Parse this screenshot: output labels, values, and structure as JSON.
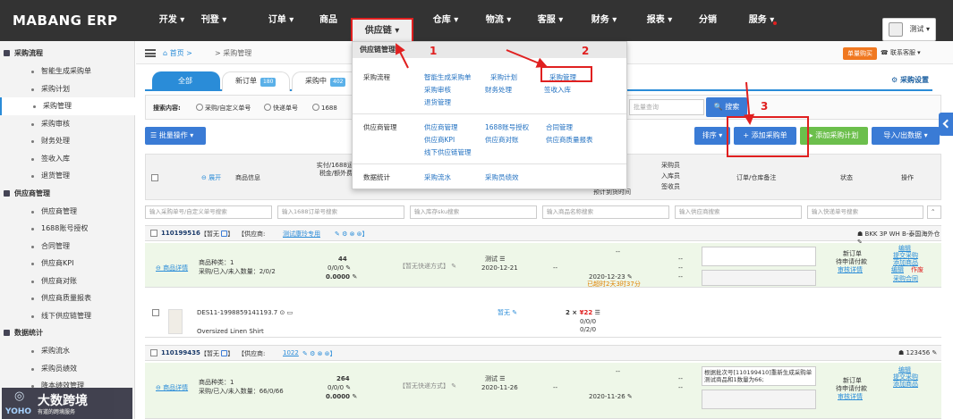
{
  "app": {
    "logo": "MABANG ERP",
    "user_label": "测试"
  },
  "nav": [
    {
      "label": "开发",
      "arrow": true
    },
    {
      "label": "刊登",
      "arrow": true
    },
    {
      "label": "订单",
      "arrow": true
    },
    {
      "label": "商品",
      "arrow": false
    },
    {
      "label": "供应链",
      "arrow": true
    },
    {
      "label": "仓库",
      "arrow": true
    },
    {
      "label": "物流",
      "arrow": true
    },
    {
      "label": "客服",
      "arrow": true
    },
    {
      "label": "财务",
      "arrow": true
    },
    {
      "label": "报表",
      "arrow": true
    },
    {
      "label": "分销",
      "arrow": false
    },
    {
      "label": "服务",
      "arrow": true
    }
  ],
  "sidebar": {
    "sections": [
      {
        "title": "采购流程",
        "items": [
          "智能生成采购单",
          "采购计划",
          "采购管理",
          "采购审核",
          "财务处理",
          "签收入库",
          "退货管理"
        ]
      },
      {
        "title": "供应商管理",
        "items": [
          "供应商管理",
          "1688账号授权",
          "合同管理",
          "供应商KPI",
          "供应商对账",
          "供应商质量报表",
          "线下供应链管理"
        ]
      },
      {
        "title": "数据统计",
        "items": [
          "采购流水",
          "采购员绩效",
          "降本绩效管理"
        ]
      }
    ],
    "selected": "采购管理"
  },
  "watermark": {
    "brand": "大数跨境",
    "yoho": "YOHO",
    "sub": "有道的跨境服务"
  },
  "breadcrumb": {
    "home": "首页",
    "current": "采购管理"
  },
  "topright": {
    "buy_btn": "单量购买",
    "contact": "联系客服"
  },
  "tabs": [
    {
      "label": "全部",
      "count": ""
    },
    {
      "label": "新订单",
      "count": "180"
    },
    {
      "label": "采购中",
      "count": "402"
    }
  ],
  "purchase_settings": "采购设置",
  "search": {
    "label": "搜索内容:",
    "radios": [
      "采购/自定义单号",
      "快递单号",
      "1688"
    ],
    "placeholder": "批量查询",
    "button": "搜索"
  },
  "toolbar": {
    "batch": "批量操作",
    "sort": "排序",
    "add_order": "+ 添加采购单",
    "add_plan": "添加采购计划",
    "import_export": "导入/出数据"
  },
  "table_head": {
    "expand": "展开",
    "goods_info": "商品信息",
    "cost": "实付/1688运费/税金/额外费用",
    "time": "预计到货时间",
    "buyer": "采购员",
    "in_count": "入库员",
    "sign": "签收员",
    "order_note": "订单/仓库备注",
    "status": "状态",
    "ops": "操作"
  },
  "filters": [
    "输入采购单号/自定义单号搜索",
    "输入1688订单号搜索",
    "输入库存sku搜索",
    "输入商品名称搜索",
    "输入供应商搜索",
    "输入快递单号搜索"
  ],
  "orders": [
    {
      "id": "110199516",
      "tag": "暂无",
      "supplier_label": "供应商:",
      "supplier": "测试康玲专用",
      "warehouse": "BKK 3P WH B-泰国海外仓",
      "detail_link": "商品详情",
      "kinds": "商品种类：1",
      "qty": "采购/已入/未入数量：2/0/2",
      "cost_top": "44",
      "cost_mid": "0/0/0",
      "cost_bottom": "0.0000",
      "express": "【暂无快递方式】",
      "buyer": "测试",
      "date": "2020-12-21",
      "eta": "2020-12-23",
      "overdue": "已超时2天3时37分",
      "status": "新订单",
      "status2": "待申请付款",
      "audit": "审核详情",
      "ops": [
        "编辑",
        "提交采购",
        "添加商品",
        "编辑",
        "作废",
        "采购合同"
      ],
      "note": "",
      "sku": {
        "code": "DES11-1998859141193.7",
        "name": "Oversized Linen Shirt",
        "price_label": "暂无",
        "qty": "2",
        "price": "¥22",
        "counts": "0/0/0",
        "counts2": "0/2/0"
      }
    },
    {
      "id": "110199435",
      "tag": "暂无",
      "supplier_label": "供应商:",
      "supplier": "1022",
      "warehouse": "123456",
      "detail_link": "商品详情",
      "kinds": "商品种类：1",
      "qty": "采购/已入/未入数量：66/0/66",
      "cost_top": "264",
      "cost_mid": "0/0/0",
      "cost_bottom": "0.0000",
      "express": "【暂无快递方式】",
      "buyer": "测试",
      "date": "2020-11-26",
      "eta": "2020-11-26",
      "overdue": "",
      "status": "新订单",
      "status2": "待申请付款",
      "audit": "审核详情",
      "ops": [
        "编辑",
        "提交采购",
        "添加商品"
      ],
      "note": "根据批次号[110199410]重新生成采购单测试商品和1数量为66;"
    }
  ],
  "dropdown": {
    "title": "供应链管理",
    "sections": [
      {
        "name": "采购流程",
        "links": [
          "智能生成采购单",
          "采购计划",
          "采购管理",
          "采购审核",
          "财务处理",
          "签收入库",
          "退货管理"
        ]
      },
      {
        "name": "供应商管理",
        "links": [
          "供应商管理",
          "1688账号授权",
          "合同管理",
          "供应商KPI",
          "供应商对账",
          "供应商质量报表",
          "线下供应链管理"
        ]
      },
      {
        "name": "数据统计",
        "links": [
          "采购流水",
          "采购员绩效"
        ]
      }
    ]
  },
  "annotations": [
    "1",
    "2",
    "3"
  ]
}
